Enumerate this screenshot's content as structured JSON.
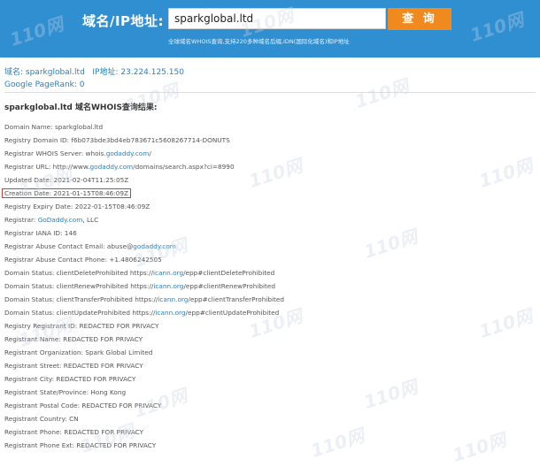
{
  "header": {
    "label": "域名/IP地址:",
    "search_value": "sparkglobal.ltd",
    "search_button": "查 询",
    "subtitle": "全球域名WHOIS查询,支持220多种域名后缀,IDN(国际化域名)和IP地址"
  },
  "info": {
    "domain_key": "域名: ",
    "domain_value": "sparkglobal.ltd",
    "ip_key": "IP地址: ",
    "ip_value": "23.224.125.150",
    "pagerank": "Google PageRank: 0"
  },
  "result_title": "sparkglobal.ltd 域名WHOIS查询结果:",
  "whois": {
    "l0": "Domain Name: sparkglobal.ltd",
    "l1": "Registry Domain ID: f6b073bde3bd4eb783671c5608267714-DONUTS",
    "l2a": "Registrar WHOIS Server: whois.",
    "l2b": "godaddy.com",
    "l2c": "/",
    "l3a": "Registrar URL: http://www.",
    "l3b": "godaddy.com",
    "l3c": "/domains/search.aspx?ci=8990",
    "l4": "Updated Date: 2021-02-04T11:25:05Z",
    "l5": "Creation Date: 2021-01-15T08:46:09Z",
    "l6": "Registry Expiry Date: 2022-01-15T08:46:09Z",
    "l7a": "Registrar: ",
    "l7b": "GoDaddy.com",
    "l7c": ", LLC",
    "l8": "Registrar IANA ID: 146",
    "l9a": "Registrar Abuse Contact Email: abuse@",
    "l9b": "godaddy.com",
    "l10": "Registrar Abuse Contact Phone: +1.4806242505",
    "l11a": "Domain Status: clientDeleteProhibited https://",
    "l11b": "icann.org",
    "l11c": "/epp#clientDeleteProhibited",
    "l12a": "Domain Status: clientRenewProhibited https://",
    "l12b": "icann.org",
    "l12c": "/epp#clientRenewProhibited",
    "l13a": "Domain Status: clientTransferProhibited https://",
    "l13b": "icann.org",
    "l13c": "/epp#clientTransferProhibited",
    "l14a": "Domain Status: clientUpdateProhibited https://",
    "l14b": "icann.org",
    "l14c": "/epp#clientUpdateProhibited",
    "l15": "Registry Registrant ID: REDACTED FOR PRIVACY",
    "l16": "Registrant Name: REDACTED FOR PRIVACY",
    "l17": "Registrant Organization: Spark Global Limited",
    "l18": "Registrant Street: REDACTED FOR PRIVACY",
    "l19": "Registrant City: REDACTED FOR PRIVACY",
    "l20": "Registrant State/Province: Hong Kong",
    "l21": "Registrant Postal Code: REDACTED FOR PRIVACY",
    "l22": "Registrant Country: CN",
    "l23": "Registrant Phone: REDACTED FOR PRIVACY",
    "l24": "Registrant Phone Ext: REDACTED FOR PRIVACY"
  },
  "watermark": "110网",
  "colors": {
    "header_bg": "#2f8fd1",
    "button_bg": "#f08a1e",
    "link": "#2a7fc0",
    "highlight_border": "#d23c3c"
  }
}
